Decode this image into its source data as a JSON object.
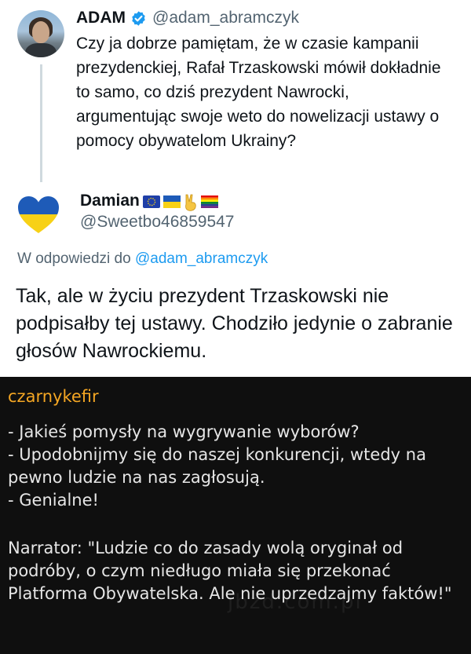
{
  "tweet": {
    "author_name": "ADAM",
    "author_handle": "@adam_abramczyk",
    "text": "Czy ja dobrze pamiętam, że w czasie kampanii prezydenckiej, Rafał Trzaskowski mówił dokładnie to samo, co dziś prezydent Nawrocki, argumentując swoje weto do nowelizacji ustawy o pomocy obywatelom Ukrainy?"
  },
  "reply": {
    "author_name": "Damian",
    "author_emojis": [
      "eu-flag",
      "ukraine-flag",
      "victory-hand",
      "rainbow-flag"
    ],
    "author_handle": "@Sweetbo46859547",
    "reply_to_prefix": "W odpowiedzi do",
    "reply_to_handle": "@adam_abramczyk",
    "text": "Tak, ale w życiu prezydent Trzaskowski nie podpisałby tej ustawy. Chodziło jedynie o zabranie głosów Nawrockiemu."
  },
  "comment": {
    "username": "czarnykefir",
    "lines": [
      "- Jakieś pomysły na wygrywanie wyborów?",
      "- Upodobnijmy się do naszej konkurencji, wtedy na pewno ludzie na nas zagłosują.",
      "- Genialne!"
    ],
    "narrator": "Narrator:  \"Ludzie co do zasady wolą oryginał od podróby, o czym niedługo miała się przekonać Platforma Obywatelska. Ale nie uprzedzajmy faktów!\"",
    "watermark": "jbzd.com.pl"
  },
  "colors": {
    "link": "#1d9bf0",
    "secondary_text": "#536471",
    "comment_background": "#0f0f0f",
    "comment_username": "#f4a623"
  }
}
